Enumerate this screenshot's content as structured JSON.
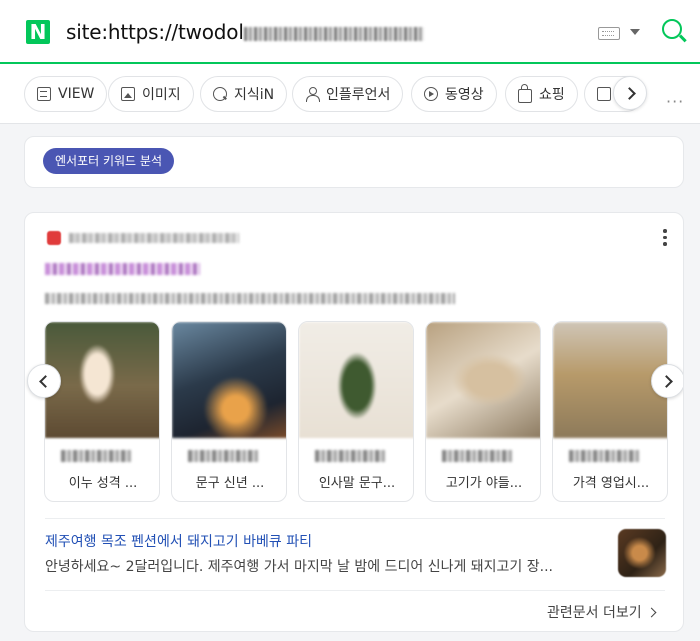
{
  "search": {
    "logo": "N",
    "query_visible": "site:https://twodol"
  },
  "tabs": [
    {
      "label": "VIEW",
      "icon": "document-icon"
    },
    {
      "label": "이미지",
      "icon": "image-icon"
    },
    {
      "label": "지식iN",
      "icon": "question-icon"
    },
    {
      "label": "인플루언서",
      "icon": "person-icon"
    },
    {
      "label": "동영상",
      "icon": "play-icon"
    },
    {
      "label": "쇼핑",
      "icon": "shopping-bag-icon"
    },
    {
      "label": "",
      "icon": "card-icon"
    }
  ],
  "keyword_badge": "엔서포터 키워드 분석",
  "result": {
    "thumbnails": [
      {
        "caption": "이누 성격 ..."
      },
      {
        "caption": "문구 신년 ..."
      },
      {
        "caption": "인사말 문구..."
      },
      {
        "caption": "고기가 야들..."
      },
      {
        "caption": "가격 영업시..."
      }
    ],
    "sub_result": {
      "title": "제주여행 목조 펜션에서 돼지고기 바베큐 파티",
      "snippet": "안녕하세요~ 2달러입니다. 제주여행 가서 마지막 날 밤에 드디어 신나게 돼지고기 장..."
    },
    "related_link": "관련문서 더보기"
  },
  "colors": {
    "brand": "#03c75a",
    "badge": "#4a56b3",
    "link": "#2250b5"
  }
}
